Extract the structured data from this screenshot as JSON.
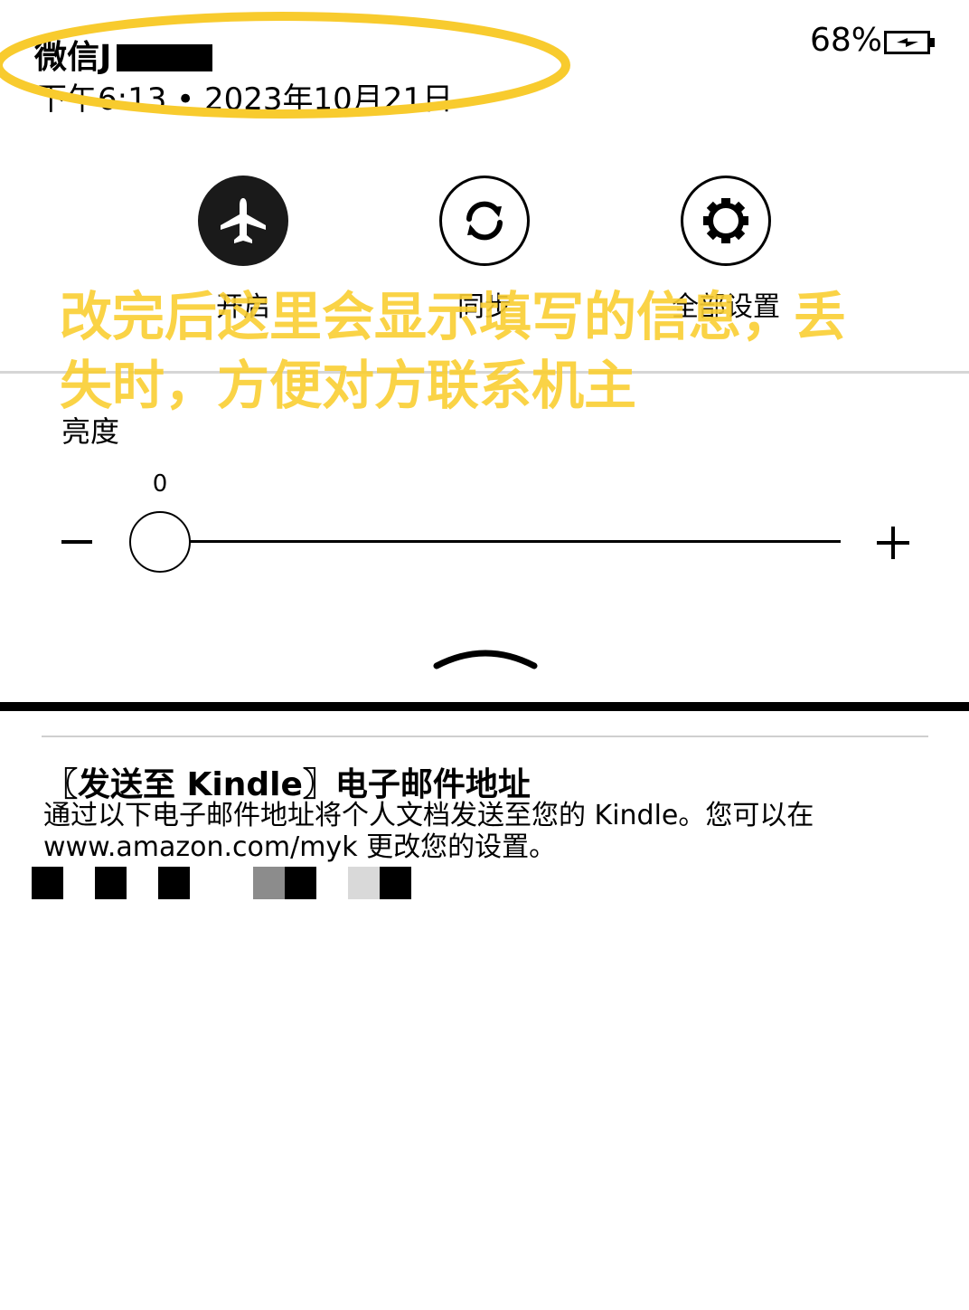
{
  "header": {
    "device_name": "微信J",
    "datetime": "下午6:13 • 2023年10月21日",
    "battery_percent": "68%",
    "battery_icon": "battery-charging-icon"
  },
  "quick_actions": [
    {
      "icon": "airplane-icon",
      "label": "开启"
    },
    {
      "icon": "sync-icon",
      "label": "同步"
    },
    {
      "icon": "gear-icon",
      "label": "全部设置"
    }
  ],
  "annotation": {
    "text": "改完后这里会显示填写的信息，丢失时，方便对方联系机主",
    "color": "#F8CB2E"
  },
  "brightness": {
    "label": "亮度",
    "value": "0",
    "level": 0,
    "minus_icon": "minus-icon",
    "plus_icon": "plus-icon"
  },
  "collapse_icon": "chevron-up-icon",
  "send_to_kindle": {
    "title": "〖发送至 Kindle〗电子邮件地址",
    "description": "通过以下电子邮件地址将个人文档发送至您的 Kindle。您可以在 www.amazon.com/myk 更改您的设置。"
  }
}
